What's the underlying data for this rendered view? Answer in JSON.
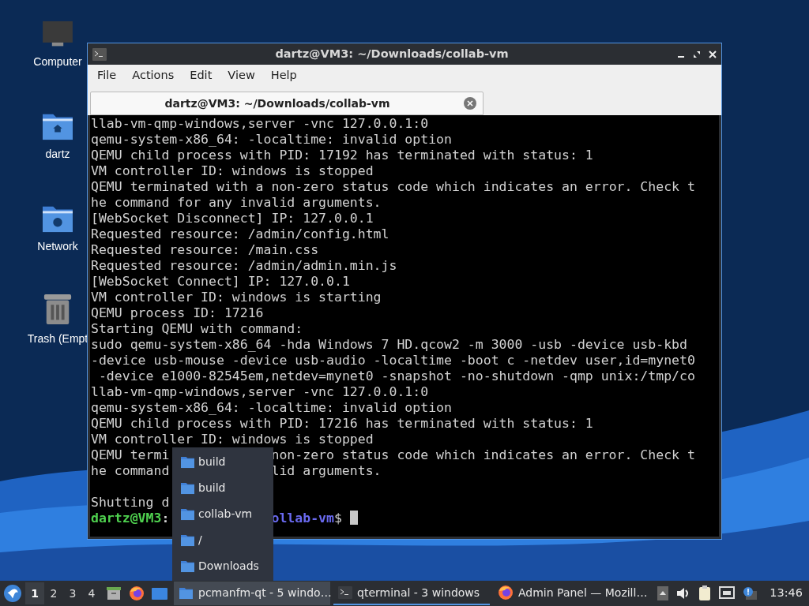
{
  "desktop_icons": [
    {
      "kind": "computer",
      "label": "Computer"
    },
    {
      "kind": "home",
      "label": "dartz"
    },
    {
      "kind": "network",
      "label": "Network"
    },
    {
      "kind": "trash",
      "label": "Trash (Empt"
    }
  ],
  "window": {
    "title": "dartz@VM3: ~/Downloads/collab-vm",
    "menu": [
      "File",
      "Actions",
      "Edit",
      "View",
      "Help"
    ],
    "tab": {
      "label": "dartz@VM3: ~/Downloads/collab-vm",
      "selected": true
    }
  },
  "terminal": {
    "lines": [
      {
        "kind": "text",
        "text": "llab-vm-qmp-windows,server -vnc 127.0.0.1:0"
      },
      {
        "kind": "text",
        "text": "qemu-system-x86_64: -localtime: invalid option"
      },
      {
        "kind": "text",
        "text": "QEMU child process with PID: 17192 has terminated with status: 1"
      },
      {
        "kind": "text",
        "text": "VM controller ID: windows is stopped"
      },
      {
        "kind": "text",
        "text": "QEMU terminated with a non-zero status code which indicates an error. Check t"
      },
      {
        "kind": "text",
        "text": "he command for any invalid arguments."
      },
      {
        "kind": "text",
        "text": "[WebSocket Disconnect] IP: 127.0.0.1"
      },
      {
        "kind": "text",
        "text": "Requested resource: /admin/config.html"
      },
      {
        "kind": "text",
        "text": "Requested resource: /main.css"
      },
      {
        "kind": "text",
        "text": "Requested resource: /admin/admin.min.js"
      },
      {
        "kind": "text",
        "text": "[WebSocket Connect] IP: 127.0.0.1"
      },
      {
        "kind": "text",
        "text": "VM controller ID: windows is starting"
      },
      {
        "kind": "text",
        "text": "QEMU process ID: 17216"
      },
      {
        "kind": "text",
        "text": "Starting QEMU with command:"
      },
      {
        "kind": "text",
        "text": "sudo qemu-system-x86_64 -hda Windows 7 HD.qcow2 -m 3000 -usb -device usb-kbd"
      },
      {
        "kind": "text",
        "text": "-device usb-mouse -device usb-audio -localtime -boot c -netdev user,id=mynet0"
      },
      {
        "kind": "text",
        "text": " -device e1000-82545em,netdev=mynet0 -snapshot -no-shutdown -qmp unix:/tmp/co"
      },
      {
        "kind": "text",
        "text": "llab-vm-qmp-windows,server -vnc 127.0.0.1:0"
      },
      {
        "kind": "text",
        "text": "qemu-system-x86_64: -localtime: invalid option"
      },
      {
        "kind": "text",
        "text": "QEMU child process with PID: 17216 has terminated with status: 1"
      },
      {
        "kind": "text",
        "text": "VM controller ID: windows is stopped"
      },
      {
        "kind": "split",
        "left": "QEMU termi",
        "right": "non-zero status code which indicates an error. Check t"
      },
      {
        "kind": "split",
        "left": "he command",
        "right": "lid arguments."
      },
      {
        "kind": "blank"
      },
      {
        "kind": "split",
        "left": "Shutting d"
      },
      {
        "kind": "prompt",
        "user": "dartz@VM3",
        "colon": ":",
        "path_right": "ollab-vm",
        "dollar": "$"
      }
    ]
  },
  "folder_menu": {
    "items": [
      "build",
      "build",
      "collab-vm",
      "/",
      "Downloads"
    ]
  },
  "taskbar": {
    "workspaces": [
      {
        "label": "1",
        "selected": true
      },
      {
        "label": "2",
        "selected": false
      },
      {
        "label": "3",
        "selected": false
      },
      {
        "label": "4",
        "selected": false
      }
    ],
    "launchers": [
      {
        "kind": "files"
      },
      {
        "kind": "firefox"
      },
      {
        "kind": "desktop"
      }
    ],
    "tasks": [
      {
        "kind": "folder",
        "label": "pcmanfm-qt - 5 windo…",
        "selected": false,
        "open": true
      },
      {
        "kind": "terminal",
        "label": "qterminal - 3 windows",
        "selected": true,
        "open": false
      },
      {
        "kind": "firefox",
        "label": "Admin Panel — Mozill…",
        "selected": false,
        "open": false
      }
    ],
    "clock": "13:46"
  }
}
